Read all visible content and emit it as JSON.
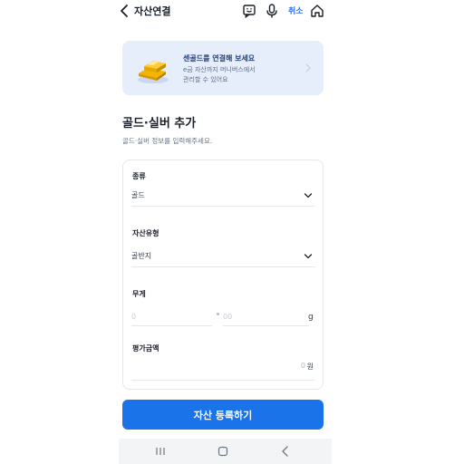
{
  "header": {
    "title": "자산연결",
    "cancel_label": "취소",
    "icons": [
      "back-icon",
      "feedback-icon",
      "microphone-icon",
      "home-icon"
    ]
  },
  "banner": {
    "title": "센골드를 연결해 보세요",
    "line1": "e금 자산까지 머니버스에서",
    "line2": "관리할 수 있어요"
  },
  "section": {
    "title": "골드·실버 추가",
    "description": "골드·실버 정보를 입력해주세요."
  },
  "form": {
    "type": {
      "label": "종류",
      "value": "골드"
    },
    "asset_type": {
      "label": "자산유형",
      "value": "골반지"
    },
    "weight": {
      "label": "무게",
      "integer_placeholder": "0",
      "decimal_placeholder": "00",
      "unit": "g"
    },
    "amount": {
      "label": "평가금액",
      "value": "0",
      "unit": "원"
    }
  },
  "cta": {
    "label": "자산 등록하기"
  },
  "navbar": {
    "icons": [
      "recent-apps-icon",
      "home-nav-icon",
      "back-nav-icon"
    ]
  },
  "colors": {
    "accent": "#1a73e8",
    "cancel": "#2f6ef0",
    "banner_bg": "#e6eefb"
  }
}
